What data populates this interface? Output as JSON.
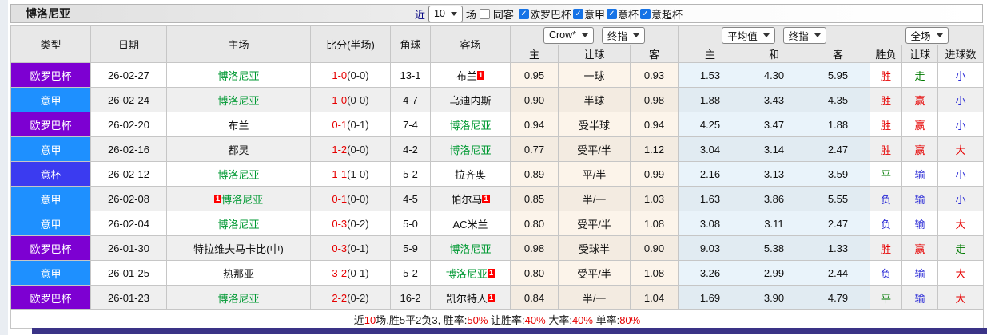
{
  "palette": {
    "red": "#e60000",
    "green": "#007a00",
    "blue": "#2b2bd6",
    "dark": "#222222",
    "team_green": "#009933",
    "europa": "#7d00d2",
    "serie_a": "#1e90ff",
    "coppa": "#3b3bf0"
  },
  "title_bar": {
    "team": "博洛尼亚",
    "near_label": "近",
    "count_value": "10",
    "matches_label": "场",
    "same_away_label": "同客",
    "league_filters": [
      {
        "label": "欧罗巴杯",
        "checked": true
      },
      {
        "label": "意甲",
        "checked": true
      },
      {
        "label": "意杯",
        "checked": true
      },
      {
        "label": "意超杯",
        "checked": true
      }
    ]
  },
  "header": {
    "static_cols": [
      "类型",
      "日期",
      "主场",
      "比分(半场)",
      "角球",
      "客场"
    ],
    "selects": {
      "bookmaker": "Crow*",
      "handicap_final": "终指",
      "average": "平均值",
      "average_final": "终指",
      "scope": "全场"
    },
    "sub_cols": [
      "主",
      "让球",
      "客",
      "主",
      "和",
      "客",
      "胜负",
      "让球",
      "进球数"
    ]
  },
  "rows": [
    {
      "league": "欧罗巴杯",
      "league_key": "europa",
      "date": "26-02-27",
      "home": {
        "name": "博洛尼亚",
        "green": true
      },
      "score": "1-0",
      "half": "(0-0)",
      "corner": "13-1",
      "away": {
        "name": "布兰",
        "green": false,
        "badge": "1"
      },
      "handicap": {
        "home": "0.95",
        "line": "一球",
        "away": "0.93"
      },
      "average": {
        "home": "1.53",
        "draw": "4.30",
        "away": "5.95"
      },
      "outcome": {
        "t": "胜",
        "c": "red"
      },
      "line_result": {
        "t": "走",
        "c": "green"
      },
      "goals": {
        "t": "小",
        "c": "blue"
      }
    },
    {
      "league": "意甲",
      "league_key": "serie_a",
      "date": "26-02-24",
      "home": {
        "name": "博洛尼亚",
        "green": true
      },
      "score": "1-0",
      "half": "(0-0)",
      "corner": "4-7",
      "away": {
        "name": "乌迪内斯",
        "green": false
      },
      "handicap": {
        "home": "0.90",
        "line": "半球",
        "away": "0.98"
      },
      "average": {
        "home": "1.88",
        "draw": "3.43",
        "away": "4.35"
      },
      "outcome": {
        "t": "胜",
        "c": "red"
      },
      "line_result": {
        "t": "赢",
        "c": "red"
      },
      "goals": {
        "t": "小",
        "c": "blue"
      }
    },
    {
      "league": "欧罗巴杯",
      "league_key": "europa",
      "date": "26-02-20",
      "home": {
        "name": "布兰",
        "green": false
      },
      "score": "0-1",
      "half": "(0-1)",
      "corner": "7-4",
      "away": {
        "name": "博洛尼亚",
        "green": true
      },
      "handicap": {
        "home": "0.94",
        "line": "受半球",
        "away": "0.94"
      },
      "average": {
        "home": "4.25",
        "draw": "3.47",
        "away": "1.88"
      },
      "outcome": {
        "t": "胜",
        "c": "red"
      },
      "line_result": {
        "t": "赢",
        "c": "red"
      },
      "goals": {
        "t": "小",
        "c": "blue"
      }
    },
    {
      "league": "意甲",
      "league_key": "serie_a",
      "date": "26-02-16",
      "home": {
        "name": "都灵",
        "green": false
      },
      "score": "1-2",
      "half": "(0-0)",
      "corner": "4-2",
      "away": {
        "name": "博洛尼亚",
        "green": true
      },
      "handicap": {
        "home": "0.77",
        "line": "受平/半",
        "away": "1.12"
      },
      "average": {
        "home": "3.04",
        "draw": "3.14",
        "away": "2.47"
      },
      "outcome": {
        "t": "胜",
        "c": "red"
      },
      "line_result": {
        "t": "赢",
        "c": "red"
      },
      "goals": {
        "t": "大",
        "c": "red"
      }
    },
    {
      "league": "意杯",
      "league_key": "coppa",
      "date": "26-02-12",
      "home": {
        "name": "博洛尼亚",
        "green": true
      },
      "score": "1-1",
      "half": "(1-0)",
      "corner": "5-2",
      "away": {
        "name": "拉齐奥",
        "green": false
      },
      "handicap": {
        "home": "0.89",
        "line": "平/半",
        "away": "0.99"
      },
      "average": {
        "home": "2.16",
        "draw": "3.13",
        "away": "3.59"
      },
      "outcome": {
        "t": "平",
        "c": "green"
      },
      "line_result": {
        "t": "输",
        "c": "blue"
      },
      "goals": {
        "t": "小",
        "c": "blue"
      }
    },
    {
      "league": "意甲",
      "league_key": "serie_a",
      "date": "26-02-08",
      "home": {
        "name": "博洛尼亚",
        "green": true,
        "badge_pre": "1"
      },
      "score": "0-1",
      "half": "(0-0)",
      "corner": "4-5",
      "away": {
        "name": "帕尔马",
        "green": false,
        "badge": "1"
      },
      "handicap": {
        "home": "0.85",
        "line": "半/一",
        "away": "1.03"
      },
      "average": {
        "home": "1.63",
        "draw": "3.86",
        "away": "5.55"
      },
      "outcome": {
        "t": "负",
        "c": "blue"
      },
      "line_result": {
        "t": "输",
        "c": "blue"
      },
      "goals": {
        "t": "小",
        "c": "blue"
      }
    },
    {
      "league": "意甲",
      "league_key": "serie_a",
      "date": "26-02-04",
      "home": {
        "name": "博洛尼亚",
        "green": true
      },
      "score": "0-3",
      "half": "(0-2)",
      "corner": "5-0",
      "away": {
        "name": "AC米兰",
        "green": false
      },
      "handicap": {
        "home": "0.80",
        "line": "受平/半",
        "away": "1.08"
      },
      "average": {
        "home": "3.08",
        "draw": "3.11",
        "away": "2.47"
      },
      "outcome": {
        "t": "负",
        "c": "blue"
      },
      "line_result": {
        "t": "输",
        "c": "blue"
      },
      "goals": {
        "t": "大",
        "c": "red"
      }
    },
    {
      "league": "欧罗巴杯",
      "league_key": "europa",
      "date": "26-01-30",
      "home": {
        "name": "特拉维夫马卡比(中)",
        "green": false
      },
      "score": "0-3",
      "half": "(0-1)",
      "corner": "5-9",
      "away": {
        "name": "博洛尼亚",
        "green": true
      },
      "handicap": {
        "home": "0.98",
        "line": "受球半",
        "away": "0.90"
      },
      "average": {
        "home": "9.03",
        "draw": "5.38",
        "away": "1.33"
      },
      "outcome": {
        "t": "胜",
        "c": "red"
      },
      "line_result": {
        "t": "赢",
        "c": "red"
      },
      "goals": {
        "t": "走",
        "c": "green"
      }
    },
    {
      "league": "意甲",
      "league_key": "serie_a",
      "date": "26-01-25",
      "home": {
        "name": "热那亚",
        "green": false
      },
      "score": "3-2",
      "half": "(0-1)",
      "corner": "5-2",
      "away": {
        "name": "博洛尼亚",
        "green": true,
        "badge": "1"
      },
      "handicap": {
        "home": "0.80",
        "line": "受平/半",
        "away": "1.08"
      },
      "average": {
        "home": "3.26",
        "draw": "2.99",
        "away": "2.44"
      },
      "outcome": {
        "t": "负",
        "c": "blue"
      },
      "line_result": {
        "t": "输",
        "c": "blue"
      },
      "goals": {
        "t": "大",
        "c": "red"
      }
    },
    {
      "league": "欧罗巴杯",
      "league_key": "europa",
      "date": "26-01-23",
      "home": {
        "name": "博洛尼亚",
        "green": true
      },
      "score": "2-2",
      "half": "(0-2)",
      "corner": "16-2",
      "away": {
        "name": "凯尔特人",
        "green": false,
        "badge": "1"
      },
      "handicap": {
        "home": "0.84",
        "line": "半/一",
        "away": "1.04"
      },
      "average": {
        "home": "1.69",
        "draw": "3.90",
        "away": "4.79"
      },
      "outcome": {
        "t": "平",
        "c": "green"
      },
      "line_result": {
        "t": "输",
        "c": "blue"
      },
      "goals": {
        "t": "大",
        "c": "red"
      }
    }
  ],
  "footer_parts": [
    {
      "t": "近",
      "c": "dark"
    },
    {
      "t": "10",
      "c": "red"
    },
    {
      "t": "场,胜5平2负3, 胜率:",
      "c": "dark"
    },
    {
      "t": "50%",
      "c": "red"
    },
    {
      "t": " 让胜率:",
      "c": "dark"
    },
    {
      "t": "40%",
      "c": "red"
    },
    {
      "t": " 大率:",
      "c": "dark"
    },
    {
      "t": "40%",
      "c": "red"
    },
    {
      "t": " 单率:",
      "c": "dark"
    },
    {
      "t": "80%",
      "c": "red"
    }
  ]
}
